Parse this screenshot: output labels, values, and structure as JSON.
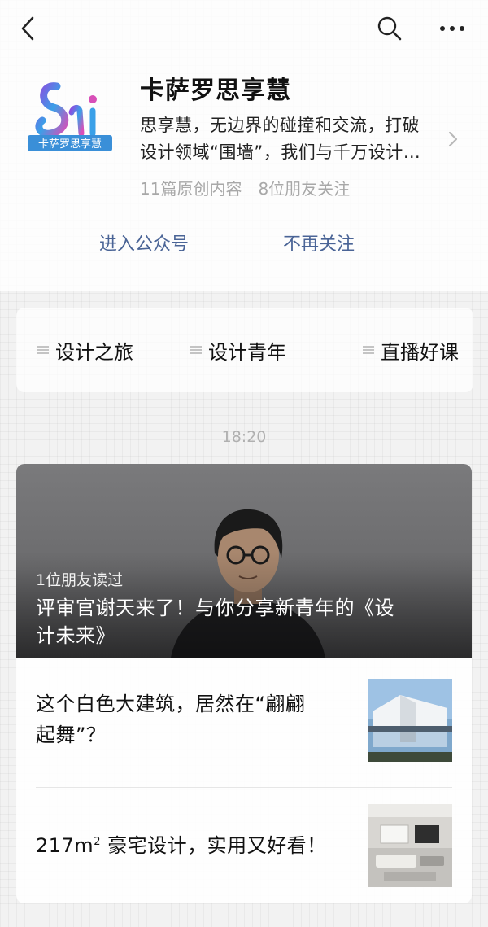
{
  "nav": {
    "back_icon": "chevron-left-icon",
    "search_icon": "search-icon",
    "more_icon": "ellipsis-icon"
  },
  "account": {
    "name": "卡萨罗思享慧",
    "logo_text": "卡萨罗思享慧",
    "desc_line1": "思享慧，无边界的碰撞和交流，打破",
    "desc_line2": "设计领域“围墙”，我们与千万设计…",
    "stat_original": "11篇原创内容",
    "stat_friends": "8位朋友关注",
    "brand_colors": [
      "#6a4fd8",
      "#3aa0e8",
      "#d84fb8"
    ]
  },
  "actions": {
    "enter": "进入公众号",
    "unfollow": "不再关注",
    "link_color": "#4a6496"
  },
  "menu": {
    "items": [
      {
        "label": "设计之旅"
      },
      {
        "label": "设计青年"
      },
      {
        "label": "直播好课"
      }
    ]
  },
  "feed": {
    "time": "18:20",
    "cover": {
      "friends_read": "1位朋友读过",
      "title_line1": "评审官谢天来了！与你分享新青年的《设",
      "title_line2": "计未来》"
    },
    "articles": [
      {
        "title_line1": "这个白色大建筑，居然在“翩翩",
        "title_line2": "起舞”？"
      },
      {
        "title_pre": "217m",
        "title_sup": "2",
        "title_post": " 豪宅设计，实用又好看！"
      }
    ]
  }
}
